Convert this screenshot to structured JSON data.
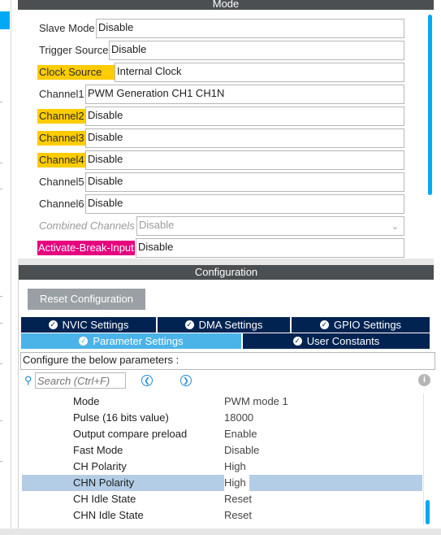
{
  "mode": {
    "title": "Mode",
    "rows": [
      {
        "label": "Slave Mode",
        "value": "Disable",
        "style": "plain"
      },
      {
        "label": "Trigger Source",
        "value": "Disable",
        "style": "plain"
      },
      {
        "label": "Clock Source",
        "value": "Internal Clock",
        "style": "yellow"
      },
      {
        "label": "Channel1",
        "value": "PWM Generation CH1 CH1N",
        "style": "plain"
      },
      {
        "label": "Channel2",
        "value": "Disable",
        "style": "yellow"
      },
      {
        "label": "Channel3",
        "value": "Disable",
        "style": "yellow"
      },
      {
        "label": "Channel4",
        "value": "Disable",
        "style": "yellow"
      },
      {
        "label": "Channel5",
        "value": "Disable",
        "style": "plain"
      },
      {
        "label": "Channel6",
        "value": "Disable",
        "style": "plain"
      },
      {
        "label": "Combined Channels",
        "value": "Disable",
        "style": "disabled"
      },
      {
        "label": "Activate-Break-Input",
        "value": "Disable",
        "style": "pink"
      }
    ]
  },
  "configuration": {
    "title": "Configuration",
    "reset_label": "Reset Configuration",
    "tabs": [
      {
        "label": "NVIC Settings",
        "active": false
      },
      {
        "label": "DMA Settings",
        "active": false
      },
      {
        "label": "GPIO Settings",
        "active": false
      },
      {
        "label": "Parameter Settings",
        "active": true
      },
      {
        "label": "User Constants",
        "active": false
      }
    ],
    "hint": "Configure the below parameters :",
    "search_placeholder": "Search (Ctrl+F)",
    "params": [
      {
        "name": "Mode",
        "value": "PWM mode 1",
        "selected": false
      },
      {
        "name": "Pulse (16 bits value)",
        "value": "18000",
        "selected": false
      },
      {
        "name": "Output compare preload",
        "value": "Enable",
        "selected": false
      },
      {
        "name": "Fast Mode",
        "value": "Disable",
        "selected": false
      },
      {
        "name": "CH Polarity",
        "value": "High",
        "selected": false
      },
      {
        "name": "CHN Polarity",
        "value": "High",
        "selected": true
      },
      {
        "name": "CH Idle State",
        "value": "Reset",
        "selected": false
      },
      {
        "name": "CHN Idle State",
        "value": "Reset",
        "selected": false
      }
    ]
  },
  "colors": {
    "header_bg": "#4b4f52",
    "tab_bg": "#002352",
    "tab_active_bg": "#4ab3e8",
    "highlight_yellow": "#ffcc00",
    "highlight_pink": "#e6007e",
    "selected_row": "#b3cde6",
    "scroll_thumb": "#03a9f4"
  }
}
